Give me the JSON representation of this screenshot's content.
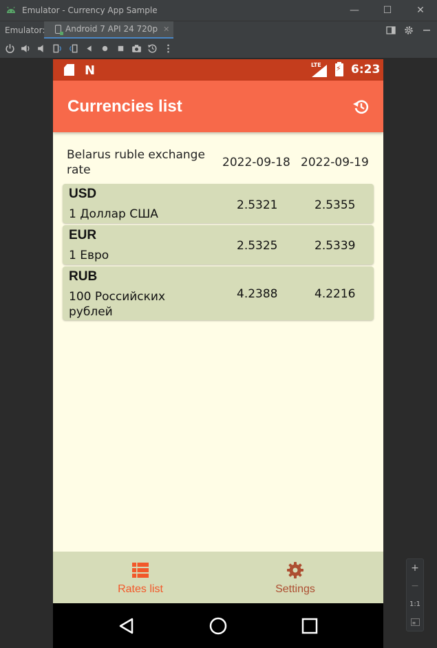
{
  "window": {
    "title": "Emulator - Currency App Sample",
    "minimize": "—",
    "maximize": "☐",
    "close": "✕"
  },
  "tabbar": {
    "label": "Emulator:",
    "tab_name": "Android 7 API 24 720p",
    "tab_close": "✕"
  },
  "statusbar": {
    "time": "6:23",
    "network": "LTE"
  },
  "appbar": {
    "title": "Currencies list"
  },
  "table": {
    "header_title": "Belarus ruble exchange rate",
    "dates": [
      "2022-09-18",
      "2022-09-19"
    ],
    "rows": [
      {
        "code": "USD",
        "name": "1 Доллар США",
        "rate1": "2.5321",
        "rate2": "2.5355"
      },
      {
        "code": "EUR",
        "name": "1 Евро",
        "rate1": "2.5325",
        "rate2": "2.5339"
      },
      {
        "code": "RUB",
        "name": "100 Российских рублей",
        "rate1": "4.2388",
        "rate2": "4.2216"
      }
    ]
  },
  "bottom_nav": {
    "items": [
      {
        "label": "Rates list",
        "icon": "list-icon",
        "active": true
      },
      {
        "label": "Settings",
        "icon": "gear-icon",
        "active": false
      }
    ]
  },
  "zoom": {
    "plus": "+",
    "minus": "−",
    "one_to_one": "1:1"
  },
  "colors": {
    "status_bar": "#c43d1d",
    "app_bar": "#f7694a",
    "background": "#fffde6",
    "card": "#d6dcb8",
    "active_nav": "#f2582a",
    "inactive_nav": "#ad4e31"
  }
}
